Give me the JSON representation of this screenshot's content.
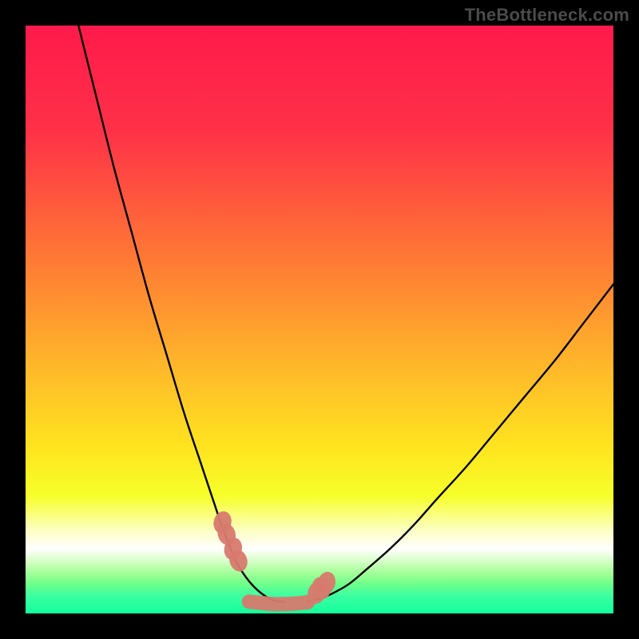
{
  "watermark": "TheBottleneck.com",
  "chart_data": {
    "type": "line",
    "title": "",
    "xlabel": "",
    "ylabel": "",
    "xlim": [
      0,
      100
    ],
    "ylim": [
      0,
      100
    ],
    "grid": false,
    "legend": false,
    "series": [
      {
        "name": "left-curve",
        "x": [
          9,
          12,
          15,
          18,
          21,
          24,
          27,
          30,
          33,
          34.5,
          36,
          38,
          40,
          42,
          44
        ],
        "values": [
          100,
          88,
          76,
          65,
          54,
          44,
          34,
          25,
          16,
          12,
          8.5,
          5.5,
          3.5,
          2.3,
          2
        ],
        "color": "#000000"
      },
      {
        "name": "right-curve",
        "x": [
          48,
          50,
          52,
          55,
          58,
          62,
          66,
          70,
          75,
          80,
          85,
          90,
          95,
          100
        ],
        "values": [
          2,
          2.5,
          3.3,
          5,
          7.5,
          11,
          15,
          19.5,
          25,
          31,
          37,
          43,
          49.5,
          56
        ],
        "color": "#000000"
      },
      {
        "name": "markers-left",
        "x": [
          33.5,
          34.2,
          35.3,
          36.2
        ],
        "values": [
          15.5,
          13.5,
          11.0,
          9.0
        ],
        "color": "#d77a6e"
      },
      {
        "name": "markers-right",
        "x": [
          49.5,
          50.3,
          51.2
        ],
        "values": [
          3.5,
          4.3,
          5.2
        ],
        "color": "#d77a6e"
      },
      {
        "name": "floor-band",
        "x": [
          38,
          40,
          42,
          44,
          46,
          48
        ],
        "values": [
          2.0,
          1.8,
          1.6,
          1.6,
          1.7,
          1.9
        ],
        "color": "#d77a6e"
      }
    ],
    "background_gradient_stops": [
      {
        "offset": 0,
        "color": "#ff1a4b"
      },
      {
        "offset": 18,
        "color": "#ff3148"
      },
      {
        "offset": 40,
        "color": "#ff7a34"
      },
      {
        "offset": 58,
        "color": "#ffb72a"
      },
      {
        "offset": 72,
        "color": "#ffe51f"
      },
      {
        "offset": 80,
        "color": "#f6ff2a"
      },
      {
        "offset": 86,
        "color": "#fdffc6"
      },
      {
        "offset": 89,
        "color": "#ffffff"
      },
      {
        "offset": 91,
        "color": "#d8ffca"
      },
      {
        "offset": 93,
        "color": "#a6ff9a"
      },
      {
        "offset": 95,
        "color": "#6fff8a"
      },
      {
        "offset": 97,
        "color": "#3cffa2"
      },
      {
        "offset": 100,
        "color": "#12ff9c"
      }
    ]
  }
}
